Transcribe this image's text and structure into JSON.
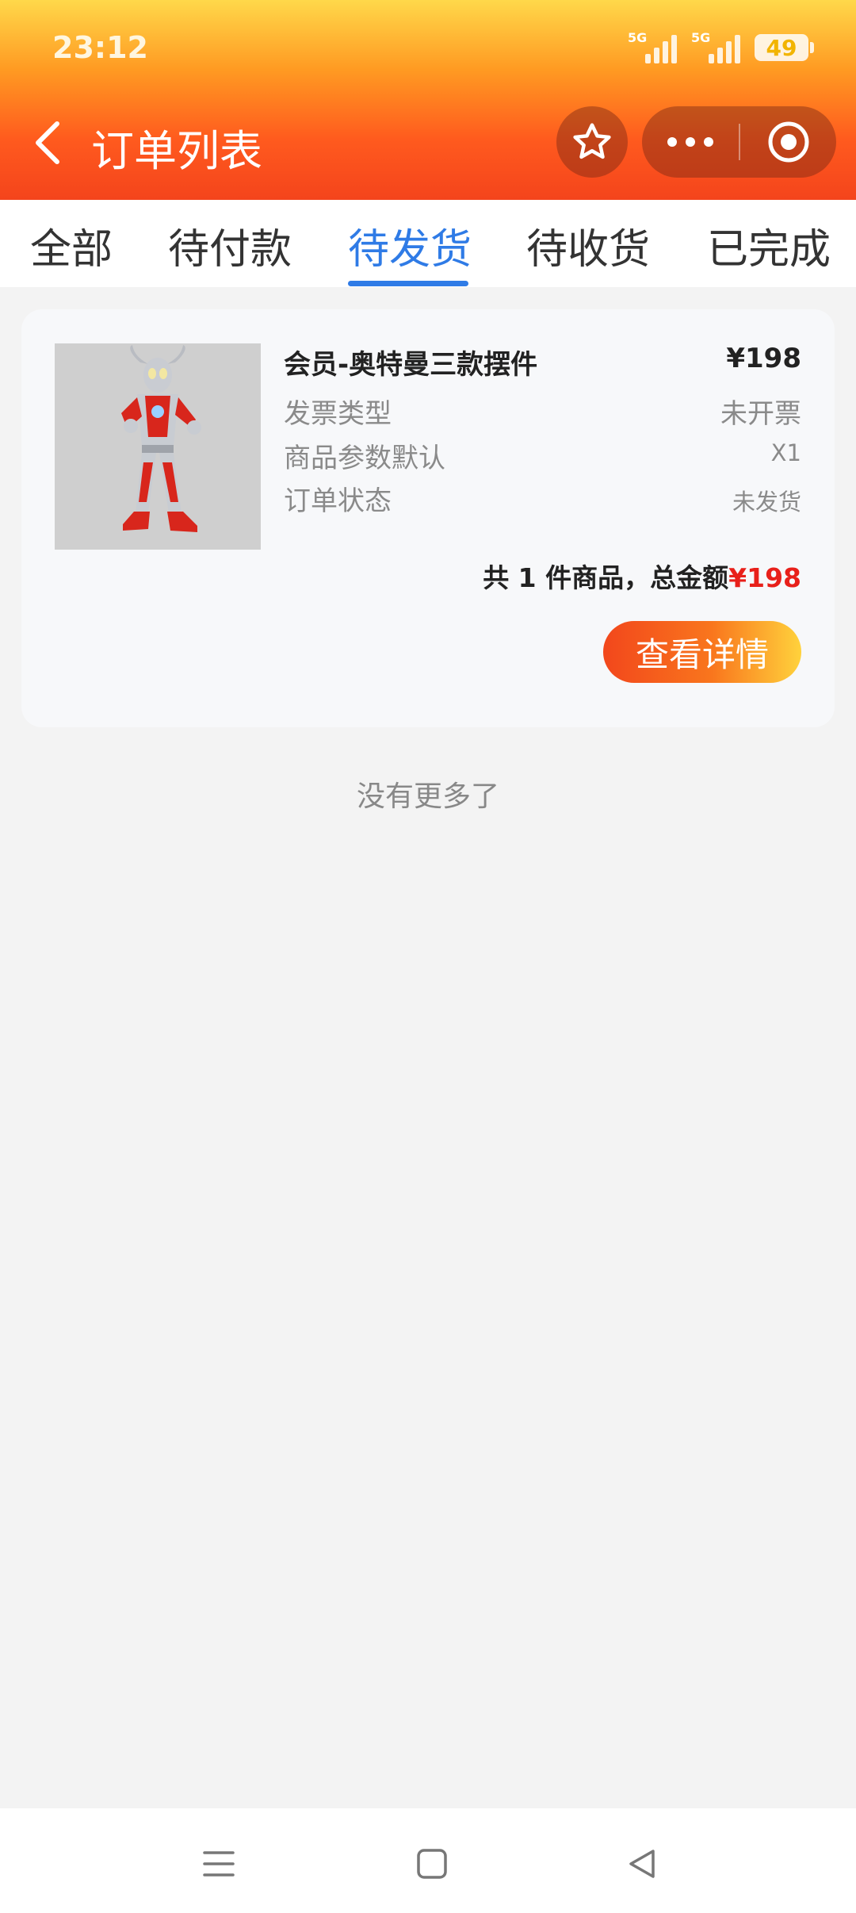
{
  "status_bar": {
    "time": "23:12",
    "signal1_tag": "5G",
    "signal2_tag": "5G",
    "battery": "49"
  },
  "header": {
    "title": "订单列表"
  },
  "tabs": [
    {
      "label": "全部"
    },
    {
      "label": "待付款"
    },
    {
      "label": "待发货"
    },
    {
      "label": "待收货"
    },
    {
      "label": "已完成"
    }
  ],
  "active_tab": "待发货",
  "order": {
    "product_name": "会员-奥特曼三款摆件",
    "price": "¥198",
    "rows": [
      {
        "label": "发票类型",
        "value": "未开票"
      },
      {
        "label": "商品参数默认",
        "value": "X1"
      },
      {
        "label": "订单状态",
        "value": "未发货"
      }
    ],
    "summary_prefix": "共 1 件商品，总金额",
    "summary_total": "¥198",
    "detail_button": "查看详情"
  },
  "list_footer": "没有更多了",
  "colors": {
    "accent_blue": "#2f7be6",
    "price_red": "#e8201a",
    "header_orange": "#f4441c"
  }
}
